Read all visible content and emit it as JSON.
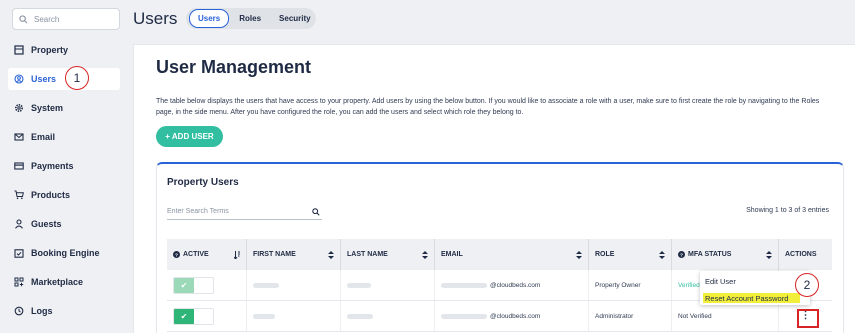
{
  "sidebar": {
    "search_placeholder": "Search",
    "items": [
      {
        "label": "Property",
        "icon": "building-icon"
      },
      {
        "label": "Users",
        "icon": "user-circle-icon",
        "active": true
      },
      {
        "label": "System",
        "icon": "gear-icon"
      },
      {
        "label": "Email",
        "icon": "envelope-icon"
      },
      {
        "label": "Payments",
        "icon": "credit-card-icon"
      },
      {
        "label": "Products",
        "icon": "cart-icon"
      },
      {
        "label": "Guests",
        "icon": "person-icon"
      },
      {
        "label": "Booking Engine",
        "icon": "calendar-check-icon"
      },
      {
        "label": "Marketplace",
        "icon": "apps-icon"
      },
      {
        "label": "Logs",
        "icon": "history-icon"
      }
    ]
  },
  "header": {
    "title": "Users",
    "tabs": [
      {
        "label": "Users",
        "active": true
      },
      {
        "label": "Roles"
      },
      {
        "label": "Security"
      }
    ]
  },
  "main": {
    "title": "User Management",
    "description": "The table below displays the users that have access to your property. Add users by using the below button. If you would like to associate a role with a user, make sure to first create the role by navigating to the Roles page, in the side menu. After you have configured the role, you can add the users and select which role they belong to.",
    "add_user_label": "+ ADD USER"
  },
  "card": {
    "title": "Property Users",
    "search_placeholder": "Enter Search Terms",
    "entries_text": "Showing 1 to 3 of 3 entries",
    "columns": [
      "ACTIVE",
      "FIRST NAME",
      "LAST NAME",
      "EMAIL",
      "ROLE",
      "MFA STATUS",
      "ACTIONS"
    ],
    "rows": [
      {
        "email_suffix": "@cloudbeds.com",
        "role": "Property Owner",
        "mfa": "Verified",
        "active_color": "#9bd9b9"
      },
      {
        "email_suffix": "@cloudbeds.com",
        "role": "Administrator",
        "mfa": "Not Verified",
        "active_color": "#2fb577"
      }
    ]
  },
  "dropdown": {
    "items": [
      "Edit User",
      "Reset Account Password"
    ]
  },
  "annotations": [
    "1",
    "2"
  ],
  "colors": {
    "accent": "#2a63d9",
    "teal": "#32bfa1",
    "highlight": "#f2ef3a",
    "annotation_red": "#d82424"
  }
}
